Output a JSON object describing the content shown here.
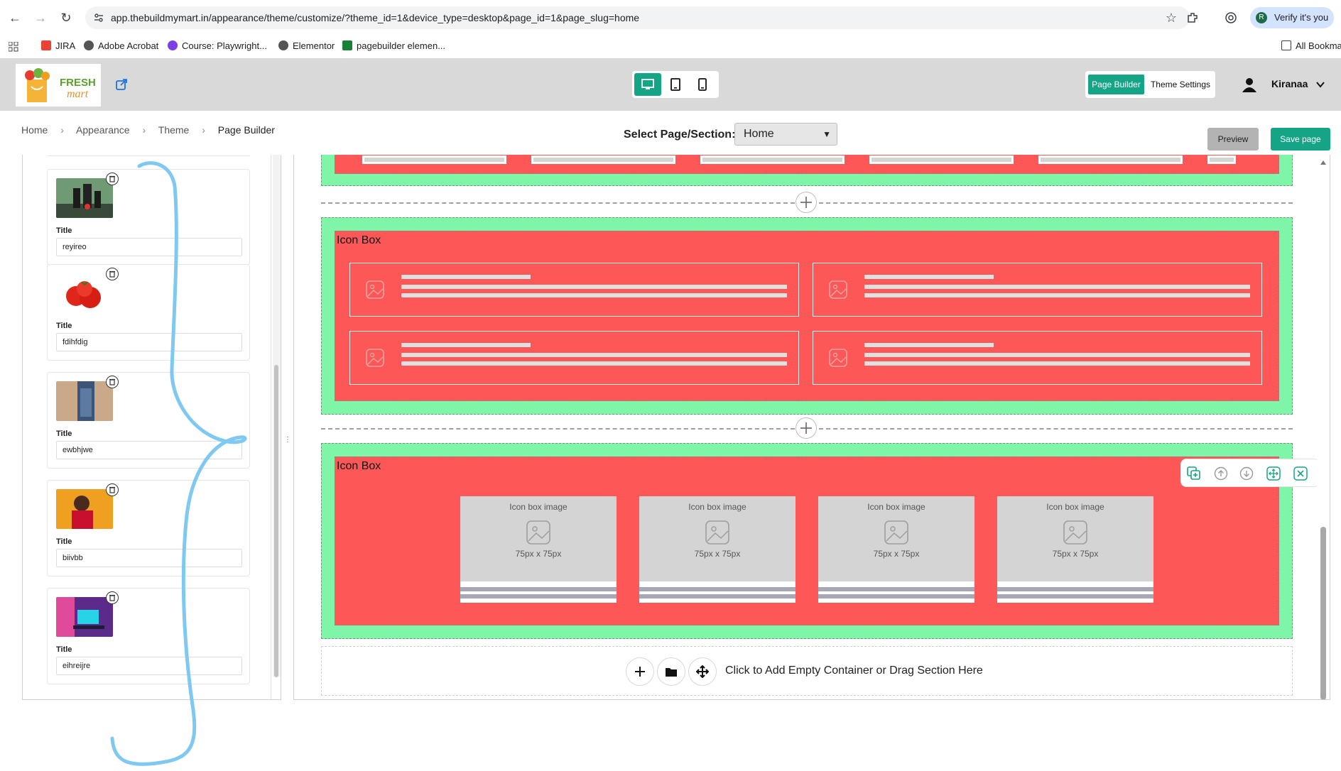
{
  "browser": {
    "url": "app.thebuildmymart.in/appearance/theme/customize/?theme_id=1&device_type=desktop&page_id=1&page_slug=home",
    "verify_label": "Verify it's you",
    "avatar_letter": "R",
    "bookmarks": [
      "JIRA",
      "Adobe Acrobat",
      "Course: Playwright...",
      "Elementor",
      "pagebuilder elemen..."
    ],
    "all_bookmarks": "All Bookma"
  },
  "header": {
    "logo_line1": "FRESH",
    "logo_line2": "mart",
    "tab_page_builder": "Page Builder",
    "tab_theme_settings": "Theme Settings",
    "user_name": "Kiranaa",
    "active_device": "desktop",
    "accent_color": "#16a487"
  },
  "breadcrumb": [
    "Home",
    "Appearance",
    "Theme",
    "Page Builder"
  ],
  "page_select": {
    "label": "Select Page/Section:",
    "value": "Home"
  },
  "actions": {
    "preview": "Preview",
    "save": "Save page"
  },
  "left_panel": {
    "items": [
      {
        "title_label": "Title",
        "value": "reyireo"
      },
      {
        "title_label": "Title",
        "value": "fdihfdig"
      },
      {
        "title_label": "Title",
        "value": "ewbhjwe"
      },
      {
        "title_label": "Title",
        "value": "biivbb"
      },
      {
        "title_label": "Title",
        "value": "eihreijre"
      }
    ]
  },
  "canvas": {
    "section_color": "#7ef5a7",
    "block_color": "#fd5757",
    "icon_box_1": {
      "label": "Icon Box"
    },
    "icon_box_2": {
      "label": "Icon Box",
      "boxes": [
        {
          "caption": "Icon box image",
          "size": "75px x 75px"
        },
        {
          "caption": "Icon box image",
          "size": "75px x 75px"
        },
        {
          "caption": "Icon box image",
          "size": "75px x 75px"
        },
        {
          "caption": "Icon box image",
          "size": "75px x 75px"
        }
      ]
    },
    "add_container_text": "Click to Add Empty Container or Drag Section Here"
  }
}
